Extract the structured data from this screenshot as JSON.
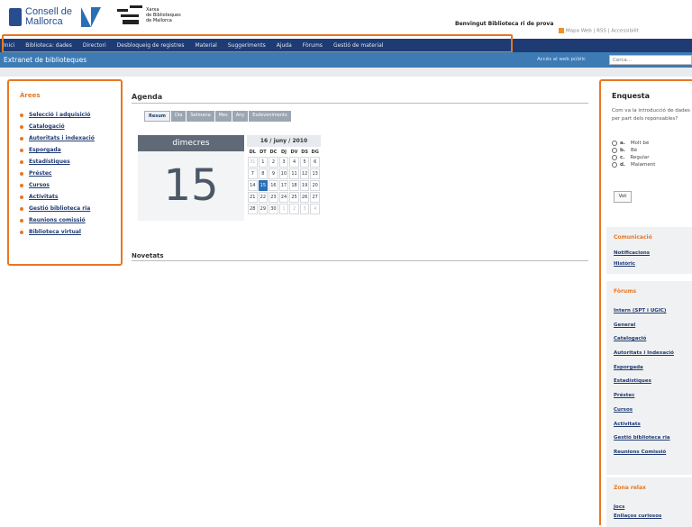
{
  "header": {
    "consell_logo_text": [
      "Consell de",
      "Mallorca"
    ],
    "xarxa_logo_text": [
      "Xarxa",
      "de Biblioteques",
      "de Mallorca"
    ],
    "welcome": "Benvingut Biblioteca ri de prova",
    "toplinks": "Mapa Web | RSS | Accessibilit"
  },
  "nav": {
    "items": [
      "Inici",
      "Biblioteca: dades",
      "Directori",
      "Desbloqueig de registres",
      "Material",
      "Suggeriments",
      "Ajuda",
      "Fòrums",
      "Gestió de material"
    ]
  },
  "subheader": {
    "title": "Extranet de biblioteques",
    "public_link": "Accés al web públic",
    "search_placeholder": "Cerca..."
  },
  "areas": {
    "title": "Àrees",
    "items": [
      "Selecció i adquisició",
      "Catalogació",
      "Autoritats i indexació",
      "Esporgada",
      "Estadístiques",
      "Préstec",
      "Cursos",
      "Activitats",
      "Gestió biblioteca ria",
      "Reunions comissió",
      "Biblioteca virtual"
    ]
  },
  "agenda": {
    "title": "Agenda",
    "tabs": [
      "Resum",
      "Dia",
      "Setmana",
      "Mes",
      "Any",
      "Esdeveniments"
    ],
    "day_name": "dimecres",
    "day_number": "15",
    "month_label": "16 / juny / 2010",
    "weekdays": [
      "DL",
      "DT",
      "DC",
      "DJ",
      "DV",
      "DS",
      "DG"
    ],
    "weeks": [
      [
        "31",
        "1",
        "2",
        "3",
        "4",
        "5",
        "6"
      ],
      [
        "7",
        "8",
        "9",
        "10",
        "11",
        "12",
        "13"
      ],
      [
        "14",
        "15",
        "16",
        "17",
        "18",
        "19",
        "20"
      ],
      [
        "21",
        "22",
        "23",
        "24",
        "25",
        "26",
        "27"
      ],
      [
        "28",
        "29",
        "30",
        "1",
        "2",
        "3",
        "4"
      ]
    ]
  },
  "novetats": {
    "title": "Novetats"
  },
  "enquesta": {
    "title": "Enquesta",
    "question": "Com va la introducció de dades per part dels reponsables?",
    "options": [
      {
        "key": "a.",
        "label": "Molt bé"
      },
      {
        "key": "b.",
        "label": "Bé"
      },
      {
        "key": "c.",
        "label": "Regular"
      },
      {
        "key": "d.",
        "label": "Malament"
      }
    ],
    "vote_label": "Vot"
  },
  "comunicacio": {
    "title": "Comunicació",
    "items": [
      "Notificacions",
      "Històric"
    ]
  },
  "forums": {
    "title": "Fòrums",
    "items": [
      "Intern (SPT i UGIC)",
      "General",
      "Catalogació",
      "Autoritats i Indexació",
      "Esporgada",
      "Estadístiques",
      "Préstec",
      "Cursos",
      "Activitats",
      "Gestió biblioteca ria",
      "Reunions Comissió"
    ]
  },
  "relax": {
    "title": "Zona relax",
    "items": [
      "Jocs",
      "Enllaços curiosos"
    ]
  }
}
